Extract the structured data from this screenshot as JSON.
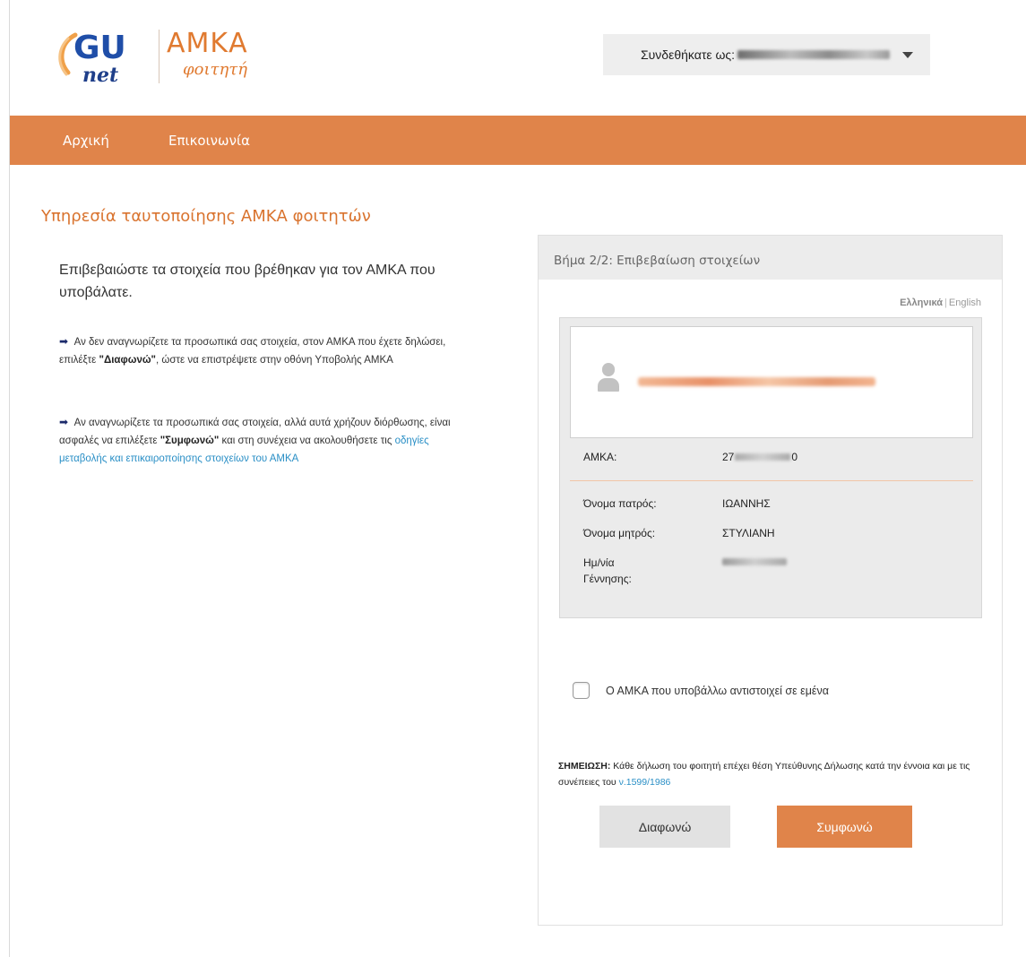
{
  "header": {
    "logo_brand": "GUnet",
    "logo_amka": "ΑΜΚΑ",
    "logo_sub": "φοιτητή",
    "logged_in_label": "Συνδεθήκατε ως:"
  },
  "nav": {
    "items": [
      {
        "label": "Αρχική"
      },
      {
        "label": "Επικοινωνία"
      }
    ]
  },
  "page": {
    "title": "Υπηρεσία ταυτοποίησης ΑΜΚΑ φοιτητών",
    "intro": "Επιβεβαιώστε τα στοιχεία που βρέθηκαν για τον ΑΜΚΑ που υποβάλατε.",
    "bullet1": {
      "pre": "Αν δεν αναγνωρίζετε τα προσωπικά σας στοιχεία, στον ΑΜΚΑ που έχετε δηλώσει, επιλέξτε ",
      "bold": "\"Διαφωνώ\"",
      "post": ", ώστε να επιστρέψετε στην οθόνη Υποβολής ΑΜΚΑ"
    },
    "bullet2": {
      "pre": "Αν αναγνωρίζετε τα προσωπικά σας στοιχεία, αλλά αυτά χρήζουν διόρθωσης, είναι ασφαλές να επιλέξετε ",
      "bold": "\"Συμφωνώ\"",
      "mid": " και στη συνέχεια να ακολουθήσετε τις ",
      "link": "οδηγίες μεταβολής και επικαιροποίησης στοιχείων του ΑΜΚΑ"
    }
  },
  "panel": {
    "step_title": "Βήμα 2/2: Επιβεβαίωση στοιχείων",
    "lang_current": "Ελληνικά",
    "lang_sep": "|",
    "lang_other": "English",
    "amka_label": "ΑΜΚΑ:",
    "amka_prefix": "27",
    "amka_suffix": "0",
    "father_label": "Όνομα πατρός:",
    "father_value": "ΙΩΑΝΝΗΣ",
    "mother_label": "Όνομα μητρός:",
    "mother_value": "ΣΤΥΛΙΑΝΗ",
    "dob_label_1": "Ημ/νία",
    "dob_label_2": "Γέννησης:",
    "confirm_checkbox_label": "Ο ΑΜΚΑ που υποβάλλω αντιστοιχεί σε εμένα",
    "note_label": "ΣΗΜΕΙΩΣΗ:",
    "note_text": " Κάθε δήλωση του φοιτητή επέχει θέση Υπεύθυνης Δήλωσης κατά την έννοια και με τις συνέπειες του ",
    "note_law_link": "ν.1599/1986",
    "btn_disagree": "Διαφωνώ",
    "btn_agree": "Συμφωνώ"
  },
  "colors": {
    "accent": "#e0844a",
    "title": "#d9732e",
    "link": "#2a8fc6"
  }
}
